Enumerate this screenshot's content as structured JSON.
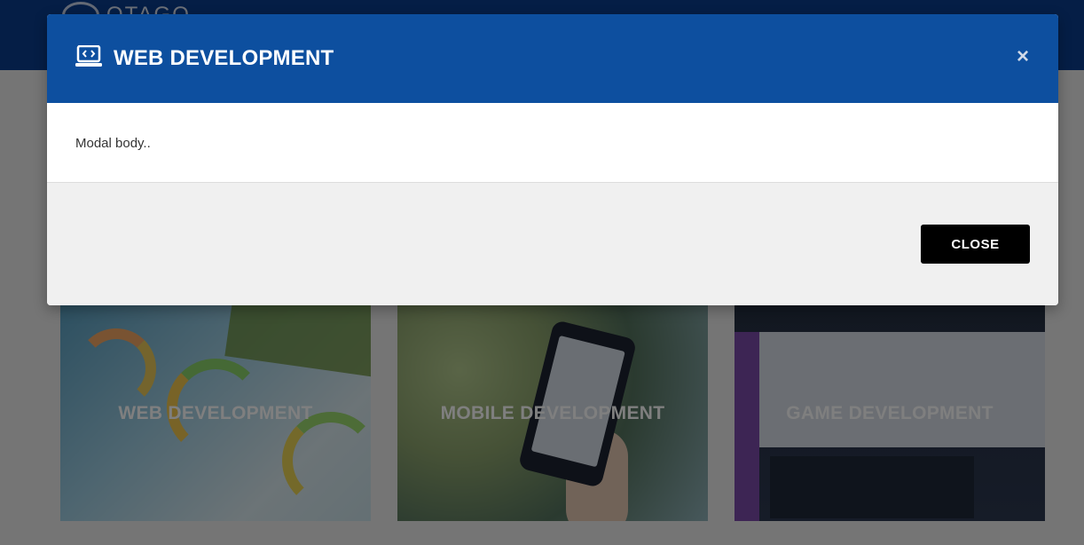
{
  "site": {
    "logo_text": "OTAGO"
  },
  "cards": [
    {
      "title": "WEB DEVELOPMENT"
    },
    {
      "title": "MOBILE DEVELOPMENT"
    },
    {
      "title": "GAME DEVELOPMENT"
    }
  ],
  "modal": {
    "title": "WEB DEVELOPMENT",
    "title_icon": "laptop-code-icon",
    "close_symbol": "×",
    "body_text": "Modal body..",
    "close_button_label": "CLOSE"
  },
  "colors": {
    "header_blue": "#0b3c8c",
    "modal_header_blue": "#0d4f9f",
    "button_black": "#000000",
    "footer_gray": "#f0f0f0"
  }
}
